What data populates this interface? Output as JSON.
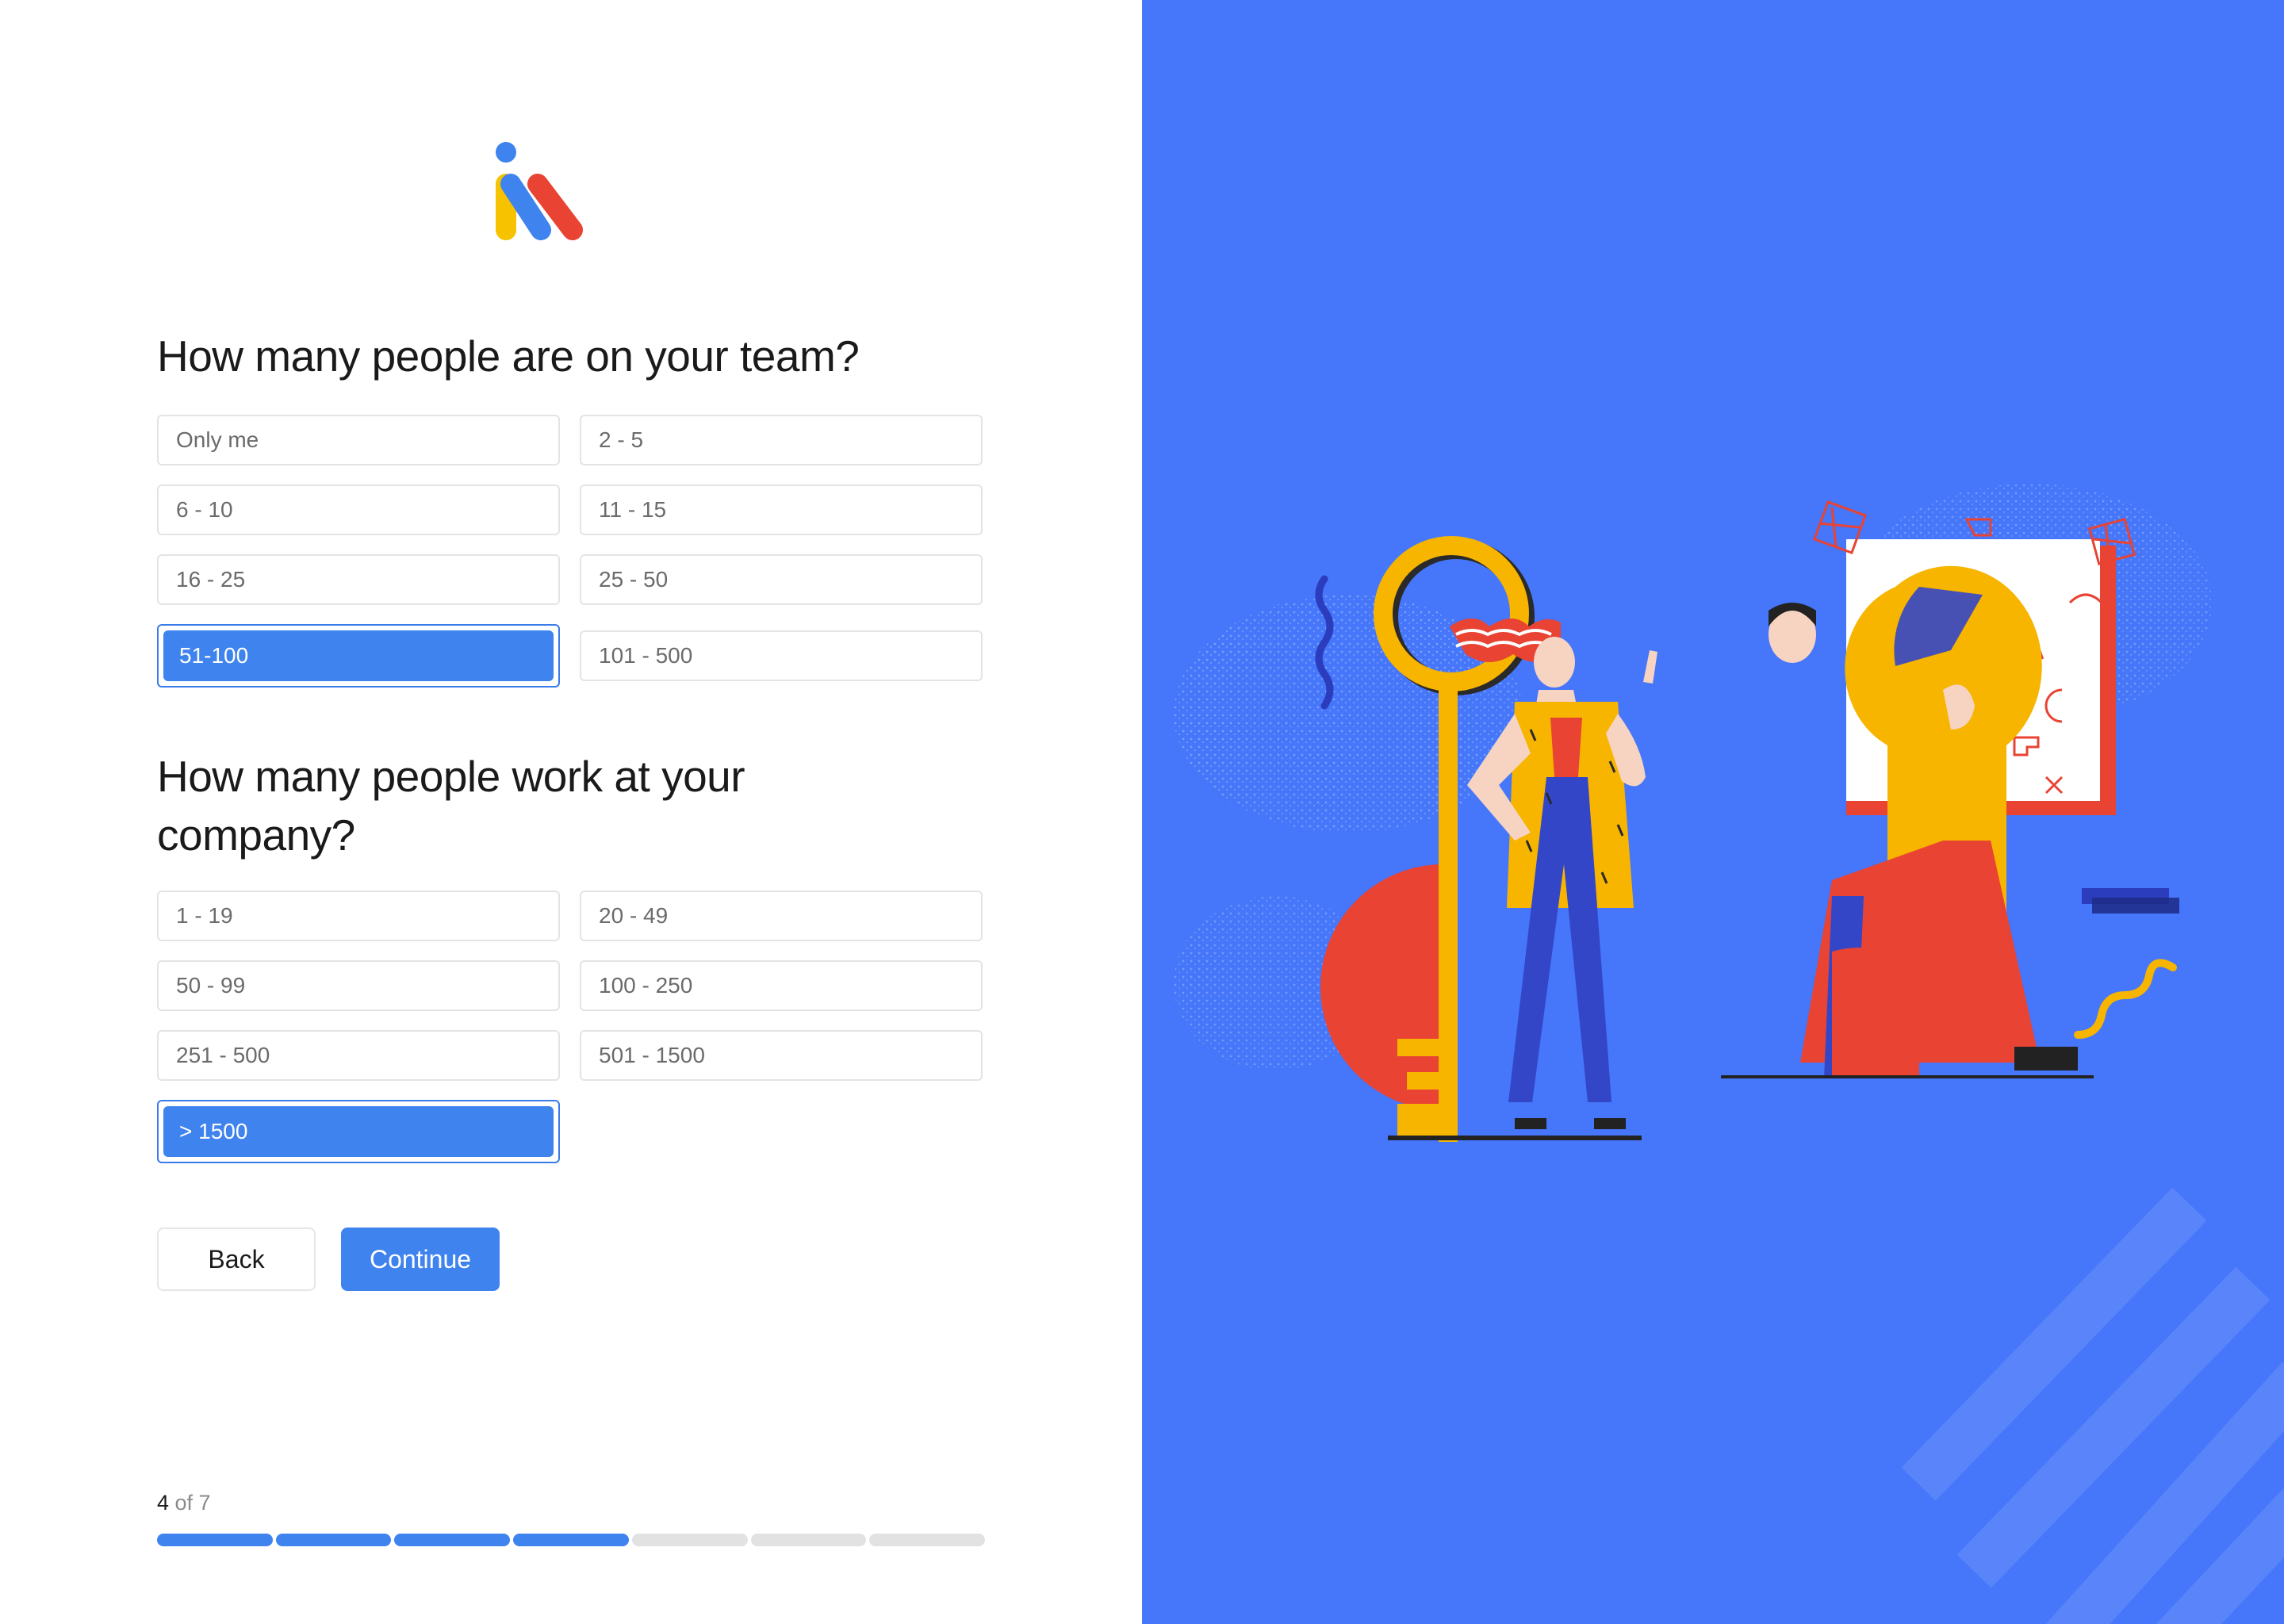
{
  "questions": {
    "team": {
      "title": "How many people are on your team?",
      "options": [
        "Only me",
        "2 - 5",
        "6 - 10",
        "11 - 15",
        "16 - 25",
        "25 - 50",
        "51-100",
        "101 - 500"
      ],
      "selected": "51-100"
    },
    "company": {
      "title": "How many people work at your company?",
      "options": [
        "1 - 19",
        "20 - 49",
        "50 - 99",
        "100 - 250",
        "251 - 500",
        "501 - 1500",
        "> 1500"
      ],
      "selected": "> 1500"
    }
  },
  "buttons": {
    "back": "Back",
    "continue": "Continue"
  },
  "progress": {
    "current": "4",
    "of_text": " of 7",
    "current_step": 4,
    "total_steps": 7
  },
  "colors": {
    "accent": "#3f83ee",
    "panel": "#4676f9"
  }
}
